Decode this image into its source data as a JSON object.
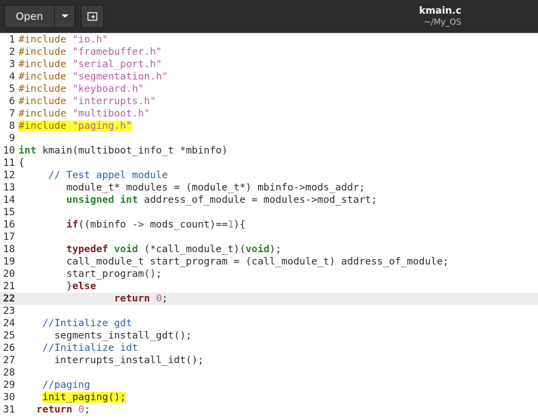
{
  "header": {
    "open_label": "Open",
    "file_name": "kmain.c",
    "file_path": "~/My_OS"
  },
  "editor": {
    "current_line": 22,
    "highlight_color": "#ffff33",
    "lines": [
      {
        "num": "1",
        "tokens": [
          {
            "c": "pp",
            "t": "#include "
          },
          {
            "c": "str",
            "t": "\"io.h\""
          }
        ]
      },
      {
        "num": "2",
        "tokens": [
          {
            "c": "pp",
            "t": "#include "
          },
          {
            "c": "str",
            "t": "\"framebuffer.h\""
          }
        ]
      },
      {
        "num": "3",
        "tokens": [
          {
            "c": "pp",
            "t": "#include "
          },
          {
            "c": "str",
            "t": "\"serial_port.h\""
          }
        ]
      },
      {
        "num": "4",
        "tokens": [
          {
            "c": "pp",
            "t": "#include "
          },
          {
            "c": "str",
            "t": "\"segmentation.h\""
          }
        ]
      },
      {
        "num": "5",
        "tokens": [
          {
            "c": "pp",
            "t": "#include "
          },
          {
            "c": "str",
            "t": "\"keyboard.h\""
          }
        ]
      },
      {
        "num": "6",
        "tokens": [
          {
            "c": "pp",
            "t": "#include "
          },
          {
            "c": "str",
            "t": "\"interrupts.h\""
          }
        ]
      },
      {
        "num": "7",
        "tokens": [
          {
            "c": "pp",
            "t": "#include "
          },
          {
            "c": "str",
            "t": "\"multiboot.h\""
          }
        ]
      },
      {
        "num": "8",
        "tokens": [
          {
            "c": "pp",
            "t": "#include ",
            "hl": true
          },
          {
            "c": "str",
            "t": "\"paging.h\"",
            "hl": true
          }
        ]
      },
      {
        "num": "9",
        "tokens": []
      },
      {
        "num": "10",
        "tokens": [
          {
            "c": "type",
            "t": "int"
          },
          {
            "c": "",
            "t": " kmain(multiboot_info_t *mbinfo)"
          }
        ]
      },
      {
        "num": "11",
        "tokens": [
          {
            "c": "",
            "t": "{"
          }
        ]
      },
      {
        "num": "12",
        "tokens": [
          {
            "c": "",
            "t": "     "
          },
          {
            "c": "cm",
            "t": "// Test appel module"
          }
        ]
      },
      {
        "num": "13",
        "tokens": [
          {
            "c": "",
            "t": "        module_t* modules = (module_t*) mbinfo->mods_addr;"
          }
        ]
      },
      {
        "num": "14",
        "tokens": [
          {
            "c": "",
            "t": "        "
          },
          {
            "c": "type",
            "t": "unsigned int"
          },
          {
            "c": "",
            "t": " address_of_module = modules->mod_start;"
          }
        ]
      },
      {
        "num": "15",
        "tokens": []
      },
      {
        "num": "16",
        "tokens": [
          {
            "c": "",
            "t": "        "
          },
          {
            "c": "kw",
            "t": "if"
          },
          {
            "c": "",
            "t": "((mbinfo -> mods_count)=="
          },
          {
            "c": "num",
            "t": "1"
          },
          {
            "c": "",
            "t": "){"
          }
        ]
      },
      {
        "num": "17",
        "tokens": []
      },
      {
        "num": "18",
        "tokens": [
          {
            "c": "",
            "t": "        "
          },
          {
            "c": "kw",
            "t": "typedef"
          },
          {
            "c": "",
            "t": " "
          },
          {
            "c": "type",
            "t": "void"
          },
          {
            "c": "",
            "t": " (*call_module_t)("
          },
          {
            "c": "type",
            "t": "void"
          },
          {
            "c": "",
            "t": ");"
          }
        ]
      },
      {
        "num": "19",
        "tokens": [
          {
            "c": "",
            "t": "        call_module_t start_program = (call_module_t) address_of_module;"
          }
        ]
      },
      {
        "num": "20",
        "tokens": [
          {
            "c": "",
            "t": "        start_program();"
          }
        ]
      },
      {
        "num": "21",
        "tokens": [
          {
            "c": "",
            "t": "        }"
          },
          {
            "c": "kw",
            "t": "else"
          }
        ]
      },
      {
        "num": "22",
        "tokens": [
          {
            "c": "",
            "t": "                "
          },
          {
            "c": "kw",
            "t": "return"
          },
          {
            "c": "",
            "t": " "
          },
          {
            "c": "num",
            "t": "0"
          },
          {
            "c": "",
            "t": ";"
          }
        ]
      },
      {
        "num": "23",
        "tokens": []
      },
      {
        "num": "24",
        "tokens": [
          {
            "c": "",
            "t": "    "
          },
          {
            "c": "cm",
            "t": "//Intialize gdt"
          }
        ]
      },
      {
        "num": "25",
        "tokens": [
          {
            "c": "",
            "t": "      segments_install_gdt();"
          }
        ]
      },
      {
        "num": "26",
        "tokens": [
          {
            "c": "",
            "t": "    "
          },
          {
            "c": "cm",
            "t": "//Initialize idt"
          }
        ]
      },
      {
        "num": "27",
        "tokens": [
          {
            "c": "",
            "t": "      interrupts_install_idt();"
          }
        ]
      },
      {
        "num": "28",
        "tokens": []
      },
      {
        "num": "29",
        "tokens": [
          {
            "c": "",
            "t": "    "
          },
          {
            "c": "cm",
            "t": "//paging"
          }
        ]
      },
      {
        "num": "30",
        "tokens": [
          {
            "c": "",
            "t": "    "
          },
          {
            "c": "",
            "t": "init_paging();",
            "hl": true
          }
        ]
      },
      {
        "num": "31",
        "tokens": [
          {
            "c": "",
            "t": "   "
          },
          {
            "c": "kw",
            "t": "return"
          },
          {
            "c": "",
            "t": " "
          },
          {
            "c": "num",
            "t": "0"
          },
          {
            "c": "",
            "t": ";"
          }
        ]
      }
    ]
  }
}
